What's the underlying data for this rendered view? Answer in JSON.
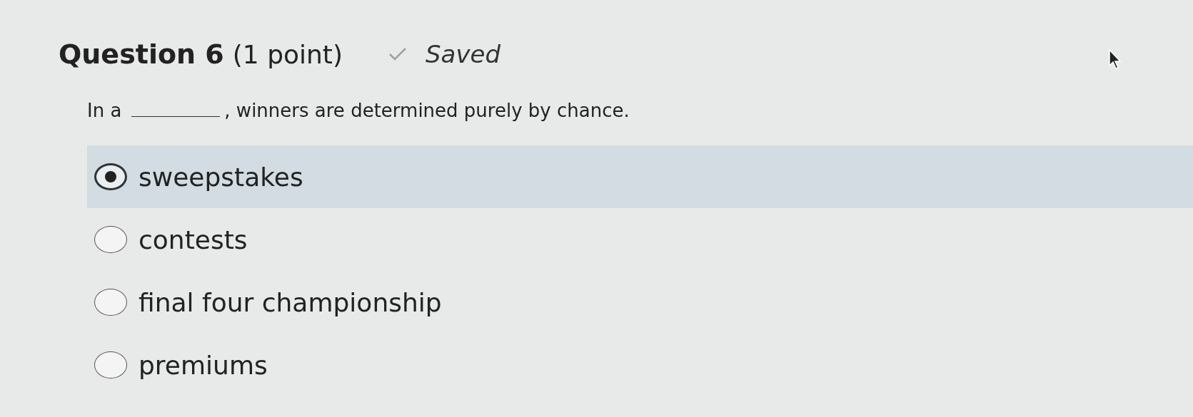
{
  "question": {
    "title": "Question 6",
    "points": "(1 point)",
    "status": "Saved",
    "saved": true,
    "text_before_blank": "In a",
    "text_after_blank": ", winners are determined purely by chance."
  },
  "options": [
    {
      "label": "sweepstakes",
      "selected": true
    },
    {
      "label": "contests",
      "selected": false
    },
    {
      "label": "final four championship",
      "selected": false
    },
    {
      "label": "premiums",
      "selected": false
    }
  ]
}
